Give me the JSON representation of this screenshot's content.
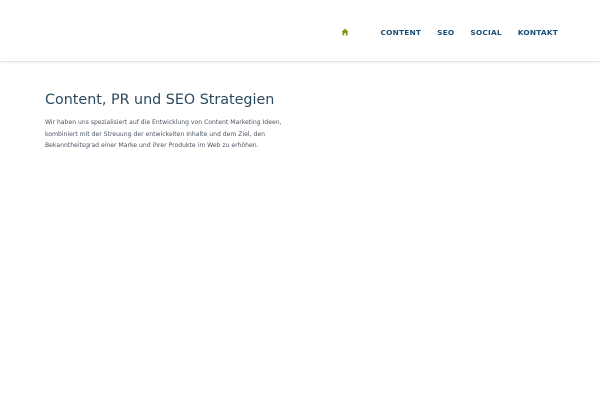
{
  "colors": {
    "nav_text": "#1a4f78",
    "home_icon": "#7a9a1e",
    "title": "#2a4a5e",
    "body_text": "#4b5560",
    "header_border": "#e4e4e4"
  },
  "nav": {
    "home_icon": "home-icon",
    "items": [
      {
        "label": "CONTENT"
      },
      {
        "label": "SEO"
      },
      {
        "label": "SOCIAL"
      },
      {
        "label": "KONTAKT"
      }
    ]
  },
  "main": {
    "title": "Content, PR und SEO Strategien",
    "intro": "Wir haben uns spezialisiert auf die Entwicklung von Content Marketing Ideen, kombiniert mit der Streuung der entwickelten Inhalte und dem Ziel, den Bekanntheitsgrad einer Marke und ihrer Produkte im Web zu erhöhen."
  }
}
